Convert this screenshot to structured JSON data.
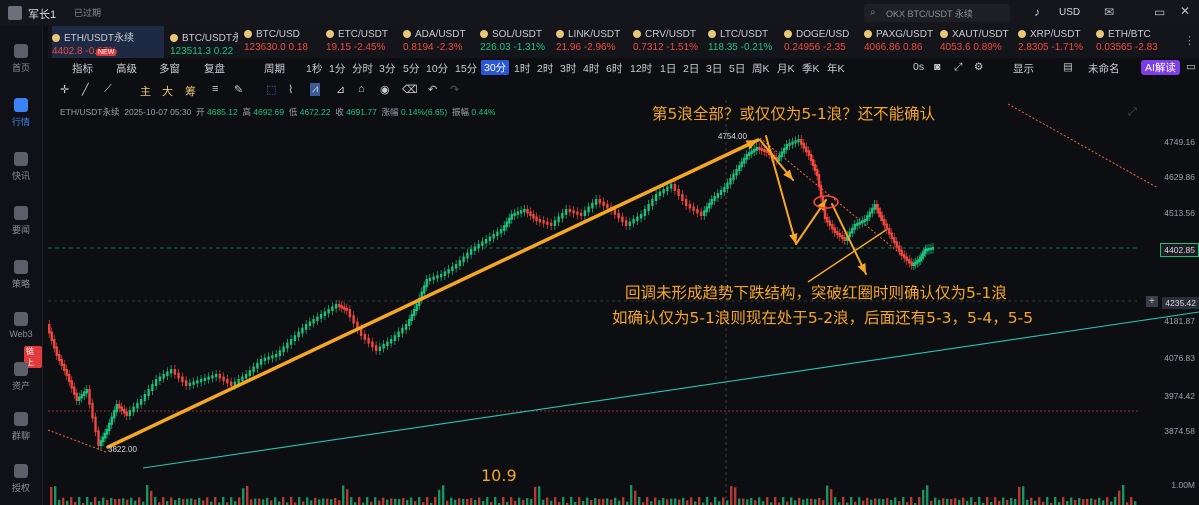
{
  "topbar": {
    "user": "军长1",
    "status": "已过期",
    "search_placeholder": "OKX BTC/USDT 永续",
    "currency": "USD"
  },
  "sidebar": {
    "items": [
      {
        "label": "首页"
      },
      {
        "label": "行情"
      },
      {
        "label": "快讯"
      },
      {
        "label": "要闻"
      },
      {
        "label": "策略"
      },
      {
        "label": "Web3"
      },
      {
        "label": "资产"
      },
      {
        "label": "群聊"
      },
      {
        "label": "授权"
      }
    ],
    "badge": "链上"
  },
  "tickers": [
    {
      "symbol": "ETH/USDT永续",
      "price": "4402.8",
      "change": "-0.67%",
      "dir": "dn",
      "badge": "NEW"
    },
    {
      "symbol": "BTC/USDT永",
      "price": "123511.3",
      "change": "0.22",
      "dir": "up"
    },
    {
      "symbol": "BTC/USD",
      "price": "123630.0",
      "change": "0.18",
      "dir": "dn"
    },
    {
      "symbol": "ETC/USDT",
      "price": "19.15",
      "change": "-2.45%",
      "dir": "dn"
    },
    {
      "symbol": "ADA/USDT",
      "price": "0.8194",
      "change": "-2.3%",
      "dir": "dn"
    },
    {
      "symbol": "SOL/USDT",
      "price": "226.03",
      "change": "-1.31%",
      "dir": "up"
    },
    {
      "symbol": "LINK/USDT",
      "price": "21.96",
      "change": "-2.96%",
      "dir": "dn"
    },
    {
      "symbol": "CRV/USDT",
      "price": "0.7312",
      "change": "-1.51%",
      "dir": "dn"
    },
    {
      "symbol": "LTC/USDT",
      "price": "118.35",
      "change": "-0.21%",
      "dir": "up"
    },
    {
      "symbol": "DOGE/USD",
      "price": "0.24956",
      "change": "-2.35",
      "dir": "dn"
    },
    {
      "symbol": "PAXG/USDT",
      "price": "4066.86",
      "change": "0.86",
      "dir": "dn"
    },
    {
      "symbol": "XAUT/USDT",
      "price": "4053.6",
      "change": "0.89%",
      "dir": "dn"
    },
    {
      "symbol": "XRP/USDT",
      "price": "2.8305",
      "change": "-1.71%",
      "dir": "dn"
    },
    {
      "symbol": "ETH/BTC",
      "price": "0.03565",
      "change": "-2.83",
      "dir": "dn"
    }
  ],
  "toolbar": {
    "left": [
      "指标",
      "高级",
      "多窗",
      "复盘",
      "周期"
    ],
    "periods": [
      "1秒",
      "1分",
      "分时",
      "3分",
      "5分",
      "10分",
      "15分",
      "30分",
      "1时",
      "2时",
      "3时",
      "4时",
      "6时",
      "12时",
      "1日",
      "2日",
      "3日",
      "5日",
      "周K",
      "月K",
      "季K",
      "年K"
    ],
    "selected_period": "30分",
    "right": [
      "0s",
      "显示",
      "未命名",
      "AI解读"
    ]
  },
  "drawtools": [
    "主",
    "大",
    "筹"
  ],
  "info": {
    "symbol": "ETH/USDT永续",
    "datetime": "2025-10-07 05:30",
    "open_label": "开",
    "open": "4685.12",
    "high_label": "高",
    "high": "4692.69",
    "low_label": "低",
    "low": "4672.22",
    "close_label": "收",
    "close": "4691.77",
    "change_label": "涨幅",
    "change": "0.14%(6.65)",
    "amp_label": "振幅",
    "amp": "0.44%"
  },
  "chart_data": {
    "type": "candlestick",
    "price_axis": [
      "4749.16",
      "4629.86",
      "4513.56",
      "4181.87",
      "4076.83",
      "3974.42",
      "3874.58",
      "1.00M"
    ],
    "current_price": "4402.85",
    "crosshair_price": "4235.42",
    "labels": {
      "high": "4754.00",
      "low": "3822.00",
      "date": "10.9"
    },
    "annotations": [
      "第5浪全部？或仅仅为5-1浪？还不能确认",
      "回调未形成趋势下跌结构，突破红圈时则确认仅为5-1浪",
      "如确认仅为5-1浪则现在处于5-2浪，后面还有5-3，5-4，5-5"
    ],
    "colors": {
      "up": "#19c37d",
      "down": "#f0483e",
      "annotation": "#f5a623",
      "trend": "#26c6b0"
    }
  }
}
